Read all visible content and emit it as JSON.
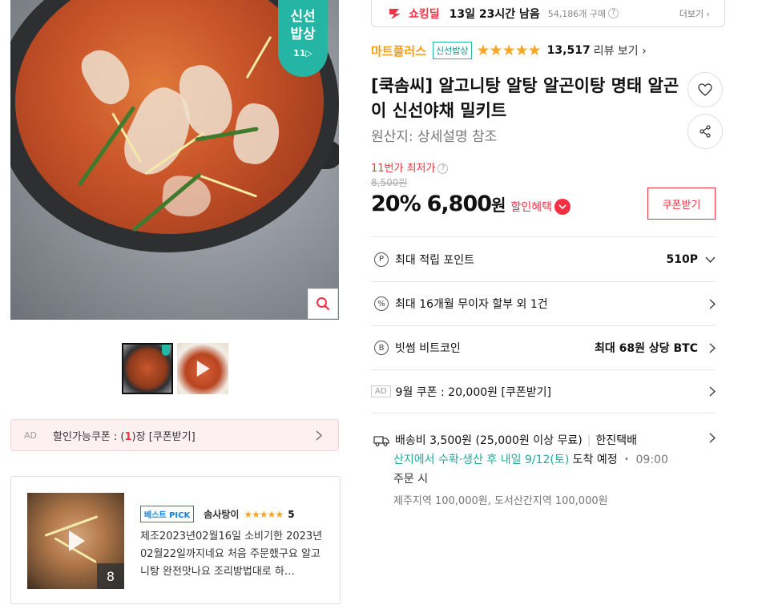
{
  "image": {
    "badge_line1": "신선",
    "badge_line2": "밥상",
    "badge_logo": "11",
    "zoom_icon": "search-icon"
  },
  "thumbnails": [
    {
      "name": "thumbnail-main"
    },
    {
      "name": "thumbnail-video"
    }
  ],
  "coupon_bar": {
    "ad": "AD",
    "text_prefix": "할인가능쿠폰 : (",
    "count": "1",
    "text_suffix": ")장 [쿠폰받기]"
  },
  "review": {
    "badge": "베스트 PICK",
    "user": "솜사탕이",
    "stars": "★★★★★",
    "score": "5",
    "image_count": "8",
    "text": "제조2023년02월16일 소비기한 2023년02월22일까지네요 처음 주문했구요 알고니탕 완전맛나요 조리방법대로 하…"
  },
  "deal": {
    "name": "쇼킹딜",
    "timer": "13일 23시간 남음",
    "buyers": "54,186개 구매",
    "more": "더보기 ›"
  },
  "seller": {
    "name": "마트플러스",
    "tag": "신선밥상",
    "stars": "★★★★★",
    "review_count": "13,517",
    "review_link": "리뷰 보기 ›"
  },
  "product": {
    "title": "[쿡솜씨] 알고니탕 알탕 알곤이탕 명태 알곤이 신선야채 밀키트",
    "origin": "원산지: 상세설명 참조"
  },
  "price": {
    "lowest_label": "11번가 최저가",
    "original": "8,500원",
    "discount": "20%",
    "amount": "6,800",
    "unit": "원",
    "benefit": "할인혜택",
    "coupon_button": "쿠폰받기"
  },
  "info_rows": {
    "points_label": "최대 적립 포인트",
    "points_value": "510P",
    "installment_label": "최대 16개월 무이자 할부 외 1건",
    "bitcoin_label": "빗썸 비트코인",
    "bitcoin_value": "최대 68원 상당 BTC",
    "ad_tag": "AD",
    "sep_coupon_label": "9월 쿠폰 : 20,000원 [쿠폰받기]"
  },
  "shipping": {
    "fee": "배송비 3,500원 (25,000원 이상 무료)",
    "carrier": "한진택배",
    "arrival": "산지에서 수확·생산 후 내일 9/12(토)",
    "arrival_suffix": " 도착 예정",
    "cutoff": " ・ 09:00",
    "order": "주문 시",
    "extra": "제주지역 100,000원, 도서산간지역 100,000원"
  },
  "colors": {
    "accent_red": "#f43142",
    "seller_orange": "#f59d11",
    "fresh_teal": "#24b5a4",
    "star_gold": "#f5a623"
  }
}
